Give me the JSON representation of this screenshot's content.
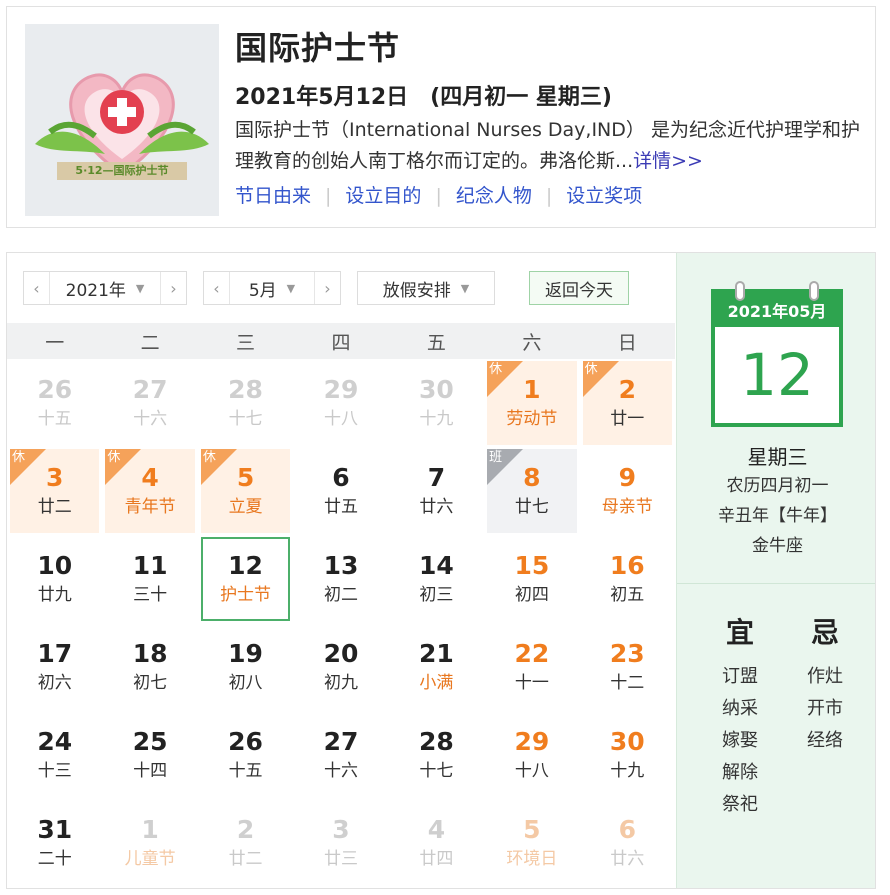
{
  "header": {
    "title": "国际护士节",
    "date_line": "2021年5月12日　(四月初一 星期三)",
    "description": "国际护士节（International Nurses Day,IND） 是为纪念近代护理学和护理教育的创始人南丁格尔而订定的。弗洛伦斯...",
    "more_label": "详情>>",
    "links": [
      "节日由来",
      "设立目的",
      "纪念人物",
      "设立奖项"
    ],
    "logo_text": "5·12—国际护士节"
  },
  "toolbar": {
    "year_value": "2021年",
    "month_value": "5月",
    "holiday_value": "放假安排",
    "today_button": "返回今天"
  },
  "weekdays": [
    "一",
    "二",
    "三",
    "四",
    "五",
    "六",
    "日"
  ],
  "badges": {
    "rest": "休",
    "work": "班"
  },
  "days": [
    {
      "n": "26",
      "l": "十五",
      "other": true
    },
    {
      "n": "27",
      "l": "十六",
      "other": true
    },
    {
      "n": "28",
      "l": "十七",
      "other": true
    },
    {
      "n": "29",
      "l": "十八",
      "other": true
    },
    {
      "n": "30",
      "l": "十九",
      "other": true
    },
    {
      "n": "1",
      "l": "劳动节",
      "type": "rest",
      "weekend": true,
      "festival": true
    },
    {
      "n": "2",
      "l": "廿一",
      "type": "rest",
      "weekend": true
    },
    {
      "n": "3",
      "l": "廿二",
      "type": "rest"
    },
    {
      "n": "4",
      "l": "青年节",
      "type": "rest",
      "festival": true
    },
    {
      "n": "5",
      "l": "立夏",
      "type": "rest",
      "festival": true
    },
    {
      "n": "6",
      "l": "廿五"
    },
    {
      "n": "7",
      "l": "廿六"
    },
    {
      "n": "8",
      "l": "廿七",
      "type": "work",
      "weekend": true
    },
    {
      "n": "9",
      "l": "母亲节",
      "weekend": true,
      "festival": true
    },
    {
      "n": "10",
      "l": "廿九"
    },
    {
      "n": "11",
      "l": "三十"
    },
    {
      "n": "12",
      "l": "护士节",
      "today": true
    },
    {
      "n": "13",
      "l": "初二"
    },
    {
      "n": "14",
      "l": "初三"
    },
    {
      "n": "15",
      "l": "初四",
      "weekend": true
    },
    {
      "n": "16",
      "l": "初五",
      "weekend": true
    },
    {
      "n": "17",
      "l": "初六"
    },
    {
      "n": "18",
      "l": "初七"
    },
    {
      "n": "19",
      "l": "初八"
    },
    {
      "n": "20",
      "l": "初九"
    },
    {
      "n": "21",
      "l": "小满",
      "festival": true
    },
    {
      "n": "22",
      "l": "十一",
      "weekend": true
    },
    {
      "n": "23",
      "l": "十二",
      "weekend": true
    },
    {
      "n": "24",
      "l": "十三"
    },
    {
      "n": "25",
      "l": "十四"
    },
    {
      "n": "26",
      "l": "十五"
    },
    {
      "n": "27",
      "l": "十六"
    },
    {
      "n": "28",
      "l": "十七"
    },
    {
      "n": "29",
      "l": "十八",
      "weekend": true
    },
    {
      "n": "30",
      "l": "十九",
      "weekend": true
    },
    {
      "n": "31",
      "l": "二十"
    },
    {
      "n": "1",
      "l": "儿童节",
      "other": true,
      "festival": true
    },
    {
      "n": "2",
      "l": "廿二",
      "other": true
    },
    {
      "n": "3",
      "l": "廿三",
      "other": true
    },
    {
      "n": "4",
      "l": "廿四",
      "other": true
    },
    {
      "n": "5",
      "l": "环境日",
      "other": true,
      "weekend": true,
      "festival": true
    },
    {
      "n": "6",
      "l": "廿六",
      "other": true,
      "weekend": true
    }
  ],
  "side": {
    "cal_header": "2021年05月",
    "cal_day": "12",
    "weekday": "星期三",
    "lunar": "农历四月初一",
    "ganzhi": "辛丑年【牛年】",
    "zodiac": "金牛座",
    "yi_title": "宜",
    "yi_items": [
      "订盟",
      "纳采",
      "嫁娶",
      "解除",
      "祭祀"
    ],
    "ji_title": "忌",
    "ji_items": [
      "作灶",
      "开市",
      "经络"
    ]
  },
  "colors": {
    "accent": "#2ea44f",
    "holiday": "#f07d1e",
    "rest_bg": "#fff1e5",
    "link": "#3355cc"
  }
}
